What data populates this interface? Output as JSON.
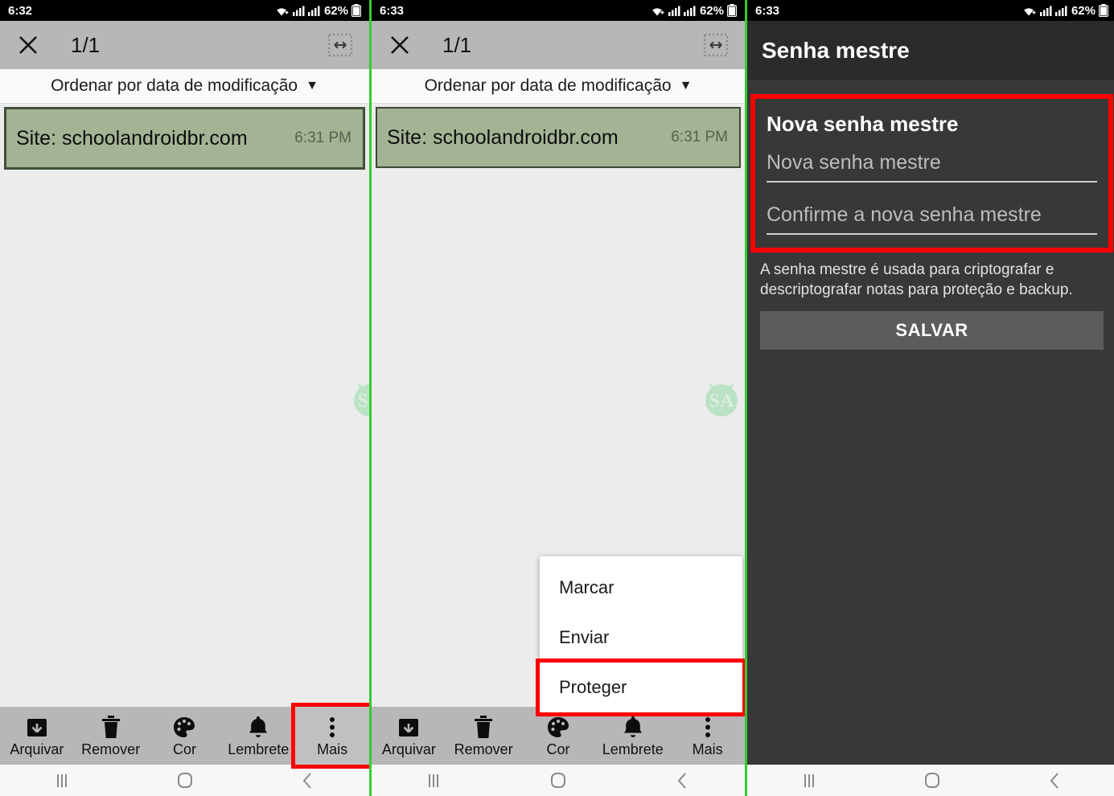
{
  "panels": [
    {
      "id": "notes-list-more-highlighted",
      "status": {
        "time": "6:32",
        "battery": "62%",
        "wifi_icon": "wifi-icon",
        "signal_icon": "signal-bars-icon",
        "battery_icon": "battery-icon"
      },
      "appbar": {
        "close_icon": "close-icon",
        "counter": "1/1",
        "resize_icon": "resize-icon"
      },
      "sort": {
        "label": "Ordenar por data de modificação",
        "caret": "▼"
      },
      "note": {
        "title": "Site: schoolandroidbr.com",
        "time": "6:31 PM",
        "color": "#a3b394"
      },
      "toolbar": [
        {
          "label": "Arquivar",
          "icon": "archive-icon",
          "highlighted": false
        },
        {
          "label": "Remover",
          "icon": "trash-icon",
          "highlighted": false
        },
        {
          "label": "Cor",
          "icon": "palette-icon",
          "highlighted": false
        },
        {
          "label": "Lembrete",
          "icon": "bell-icon",
          "highlighted": false
        },
        {
          "label": "Mais",
          "icon": "overflow-dots-icon",
          "highlighted": true
        }
      ],
      "nav": [
        {
          "icon": "recents-icon"
        },
        {
          "icon": "home-icon"
        },
        {
          "icon": "back-icon"
        }
      ]
    },
    {
      "id": "notes-list-menu-open",
      "status": {
        "time": "6:33",
        "battery": "62%",
        "wifi_icon": "wifi-icon",
        "signal_icon": "signal-bars-icon",
        "battery_icon": "battery-icon"
      },
      "appbar": {
        "close_icon": "close-icon",
        "counter": "1/1",
        "resize_icon": "resize-icon"
      },
      "sort": {
        "label": "Ordenar por data de modificação",
        "caret": "▼"
      },
      "note": {
        "title": "Site: schoolandroidbr.com",
        "time": "6:31 PM",
        "color": "#a3b394"
      },
      "menu": [
        {
          "label": "Marcar",
          "highlighted": false
        },
        {
          "label": "Enviar",
          "highlighted": false
        },
        {
          "label": "Proteger",
          "highlighted": true
        }
      ],
      "toolbar": [
        {
          "label": "Arquivar",
          "icon": "archive-icon",
          "highlighted": false
        },
        {
          "label": "Remover",
          "icon": "trash-icon",
          "highlighted": false
        },
        {
          "label": "Cor",
          "icon": "palette-icon",
          "highlighted": false
        },
        {
          "label": "Lembrete",
          "icon": "bell-icon",
          "highlighted": false
        },
        {
          "label": "Mais",
          "icon": "overflow-dots-icon",
          "highlighted": false
        }
      ],
      "nav": [
        {
          "icon": "recents-icon"
        },
        {
          "icon": "home-icon"
        },
        {
          "icon": "back-icon"
        }
      ]
    },
    {
      "id": "master-password-screen",
      "status": {
        "time": "6:33",
        "battery": "62%",
        "wifi_icon": "wifi-icon",
        "signal_icon": "signal-bars-icon",
        "battery_icon": "battery-icon"
      },
      "appbar": {
        "title": "Senha mestre"
      },
      "form": {
        "heading": "Nova senha mestre",
        "new_password_placeholder": "Nova senha mestre",
        "confirm_password_placeholder": "Confirme a nova senha mestre",
        "new_password_value": "",
        "confirm_password_value": "",
        "helper": "A senha mestre é usada para criptografar e descriptografar notas para proteção e backup.",
        "save_label": "SALVAR"
      },
      "nav": [
        {
          "icon": "recents-icon"
        },
        {
          "icon": "home-icon"
        },
        {
          "icon": "back-icon"
        }
      ]
    }
  ],
  "colors": {
    "highlight": "#ff0000",
    "divider": "#33cc33",
    "note_green": "#a3b394",
    "appbar_gray": "#b7b7b7",
    "dark_bg": "#383838",
    "dark_appbar": "#2b2b2b",
    "save_button": "#5c5c5c"
  },
  "watermark": {
    "label": "SA",
    "icon": "android-robot-icon"
  }
}
